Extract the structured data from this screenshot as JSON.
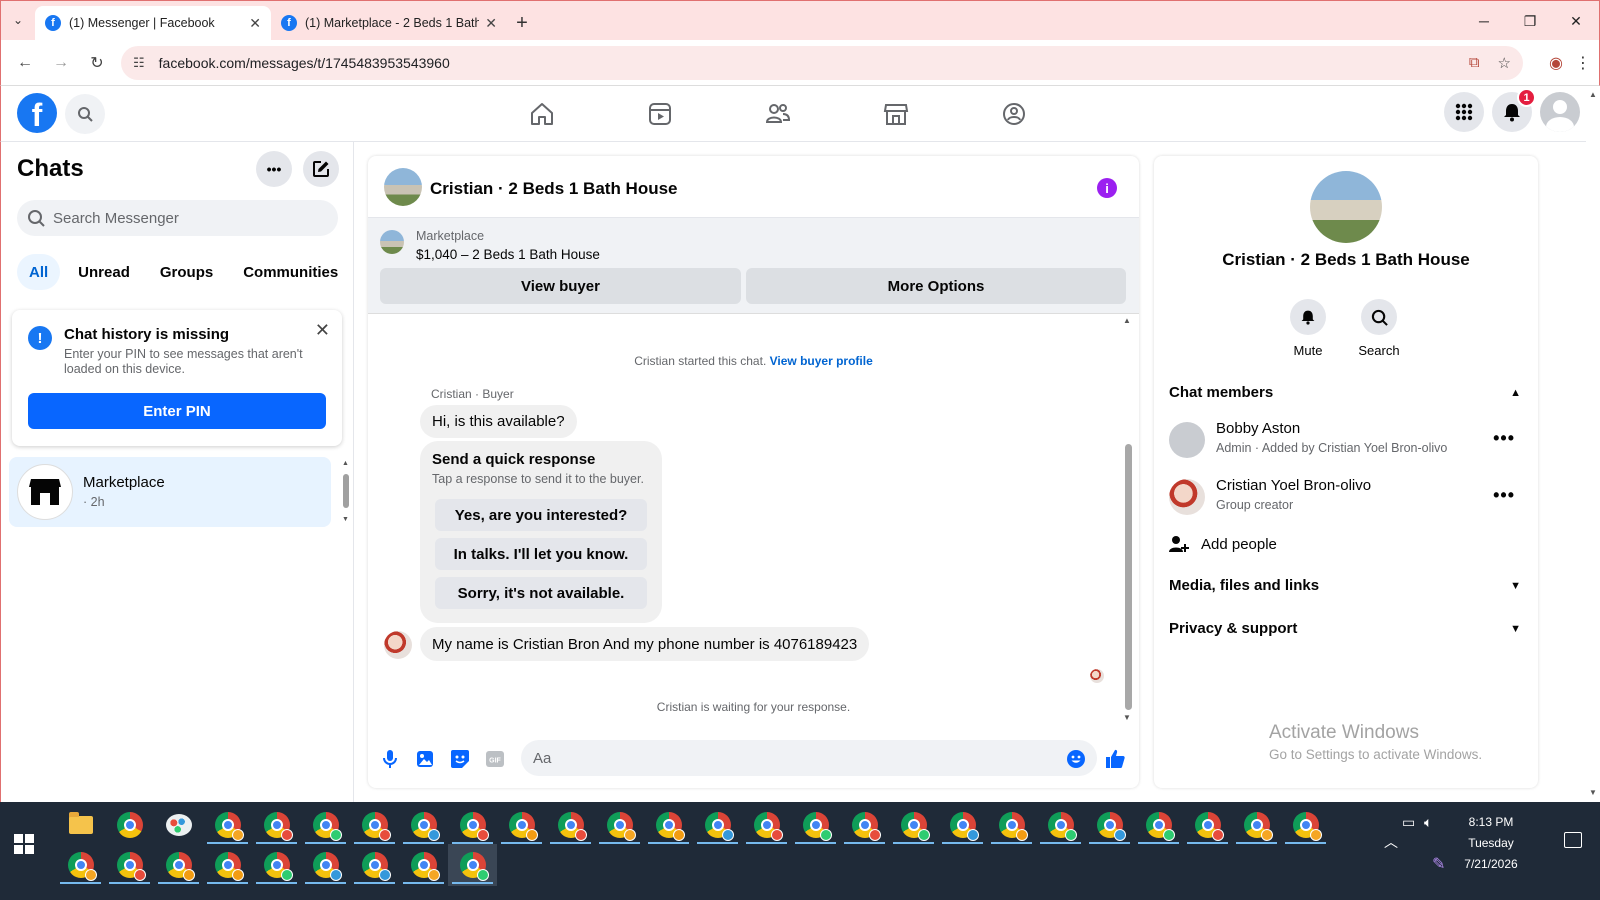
{
  "browser": {
    "tabs": [
      {
        "title": "(1) Messenger | Facebook",
        "active": true
      },
      {
        "title": "(1) Marketplace - 2 Beds 1 Bath",
        "active": false
      }
    ],
    "url": "facebook.com/messages/t/1745483953543960"
  },
  "header": {
    "notification_count": "1"
  },
  "sidebar": {
    "title": "Chats",
    "search_placeholder": "Search Messenger",
    "filters": [
      "All",
      "Unread",
      "Groups",
      "Communities"
    ],
    "notice": {
      "title": "Chat history is missing",
      "description": "Enter your PIN to see messages that aren't loaded on this device.",
      "button": "Enter PIN"
    },
    "chats": [
      {
        "name": "Marketplace",
        "time": "· 2h"
      }
    ]
  },
  "conversation": {
    "title": "Cristian · 2 Beds 1 Bath House",
    "marketplace_label": "Marketplace",
    "listing": "$1,040 – 2 Beds 1 Bath House",
    "view_buyer": "View buyer",
    "more_options": "More Options",
    "started_text": "Cristian started this chat.",
    "view_buyer_profile": "View buyer profile",
    "sender_label": "Cristian · Buyer",
    "first_message": "Hi, is this available?",
    "quick_response": {
      "title": "Send a quick response",
      "subtitle": "Tap a response to send it to the buyer.",
      "options": [
        "Yes, are you interested?",
        "In talks. I'll let you know.",
        "Sorry, it's not available."
      ]
    },
    "second_message": "My name is Cristian Bron And my phone number is 4076189423",
    "waiting_text": "Cristian is waiting for your response.",
    "input_placeholder": "Aa"
  },
  "details": {
    "name": "Cristian · 2 Beds 1 Bath House",
    "actions": [
      "Mute",
      "Search"
    ],
    "chat_members_label": "Chat members",
    "members": [
      {
        "name": "Bobby Aston",
        "role": "Admin · Added by Cristian Yoel Bron-olivo"
      },
      {
        "name": "Cristian Yoel Bron-olivo",
        "role": "Group creator"
      }
    ],
    "add_people": "Add people",
    "media_label": "Media, files and links",
    "privacy_label": "Privacy & support",
    "watermark_title": "Activate Windows",
    "watermark_sub": "Go to Settings to activate Windows."
  },
  "taskbar": {
    "time": "8:13 PM",
    "day": "Tuesday",
    "date": "7/21/2026"
  },
  "colors": {
    "accent": "#0866ff",
    "facebook_blue": "#1877f2",
    "info_purple": "#9b20f0",
    "active_chat_bg": "#e7f3ff",
    "taskbar_bg": "#1f2a38"
  }
}
